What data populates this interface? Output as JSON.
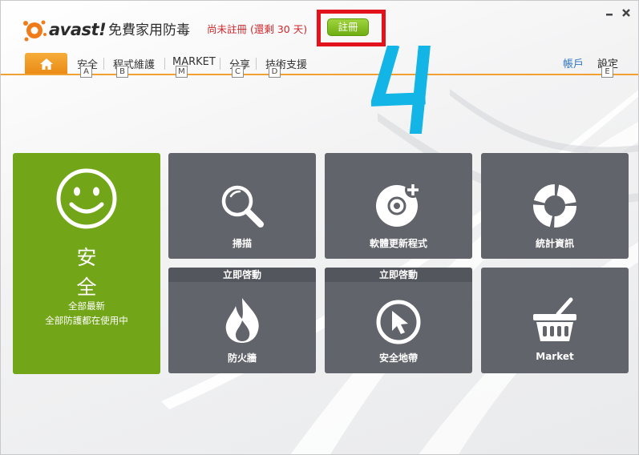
{
  "header": {
    "logo_text": "avast!",
    "product_name": "免費家用防毒",
    "registration_status": "尚未註冊 (還剩 30 天)",
    "register_button": "註冊"
  },
  "window_controls": {
    "minimize": "–",
    "close": "✕"
  },
  "nav": {
    "items": [
      {
        "label": "安全",
        "key": "A"
      },
      {
        "label": "程式維護",
        "key": "B"
      },
      {
        "label": "MARKET",
        "key": "M"
      },
      {
        "label": "分享",
        "key": "C"
      },
      {
        "label": "技術支援",
        "key": "D"
      }
    ],
    "account": "帳戶",
    "settings": "設定",
    "settings_key": "E"
  },
  "annotation": {
    "number": "4",
    "color": "#12b5e6"
  },
  "status": {
    "title_line1": "安",
    "title_line2": "全",
    "sub_line1": "全部最新",
    "sub_line2": "全部防護都在使用中",
    "color": "#72a517"
  },
  "tiles": [
    {
      "label": "掃描",
      "icon": "magnifier-icon"
    },
    {
      "label": "軟體更新程式",
      "icon": "disc-plus-icon"
    },
    {
      "label": "統計資訊",
      "icon": "ring-chart-icon"
    },
    {
      "label": "防火牆",
      "icon": "flame-icon",
      "banner": "立即啓動"
    },
    {
      "label": "安全地帶",
      "icon": "cursor-circle-icon",
      "banner": "立即啓動"
    },
    {
      "label": "Market",
      "icon": "basket-icon"
    }
  ],
  "colors": {
    "accent_orange": "#f2a031",
    "tile_gray": "#62646b",
    "register_green": "#7ab81c",
    "status_red": "#d0262a",
    "highlight_red": "#e2131d"
  }
}
